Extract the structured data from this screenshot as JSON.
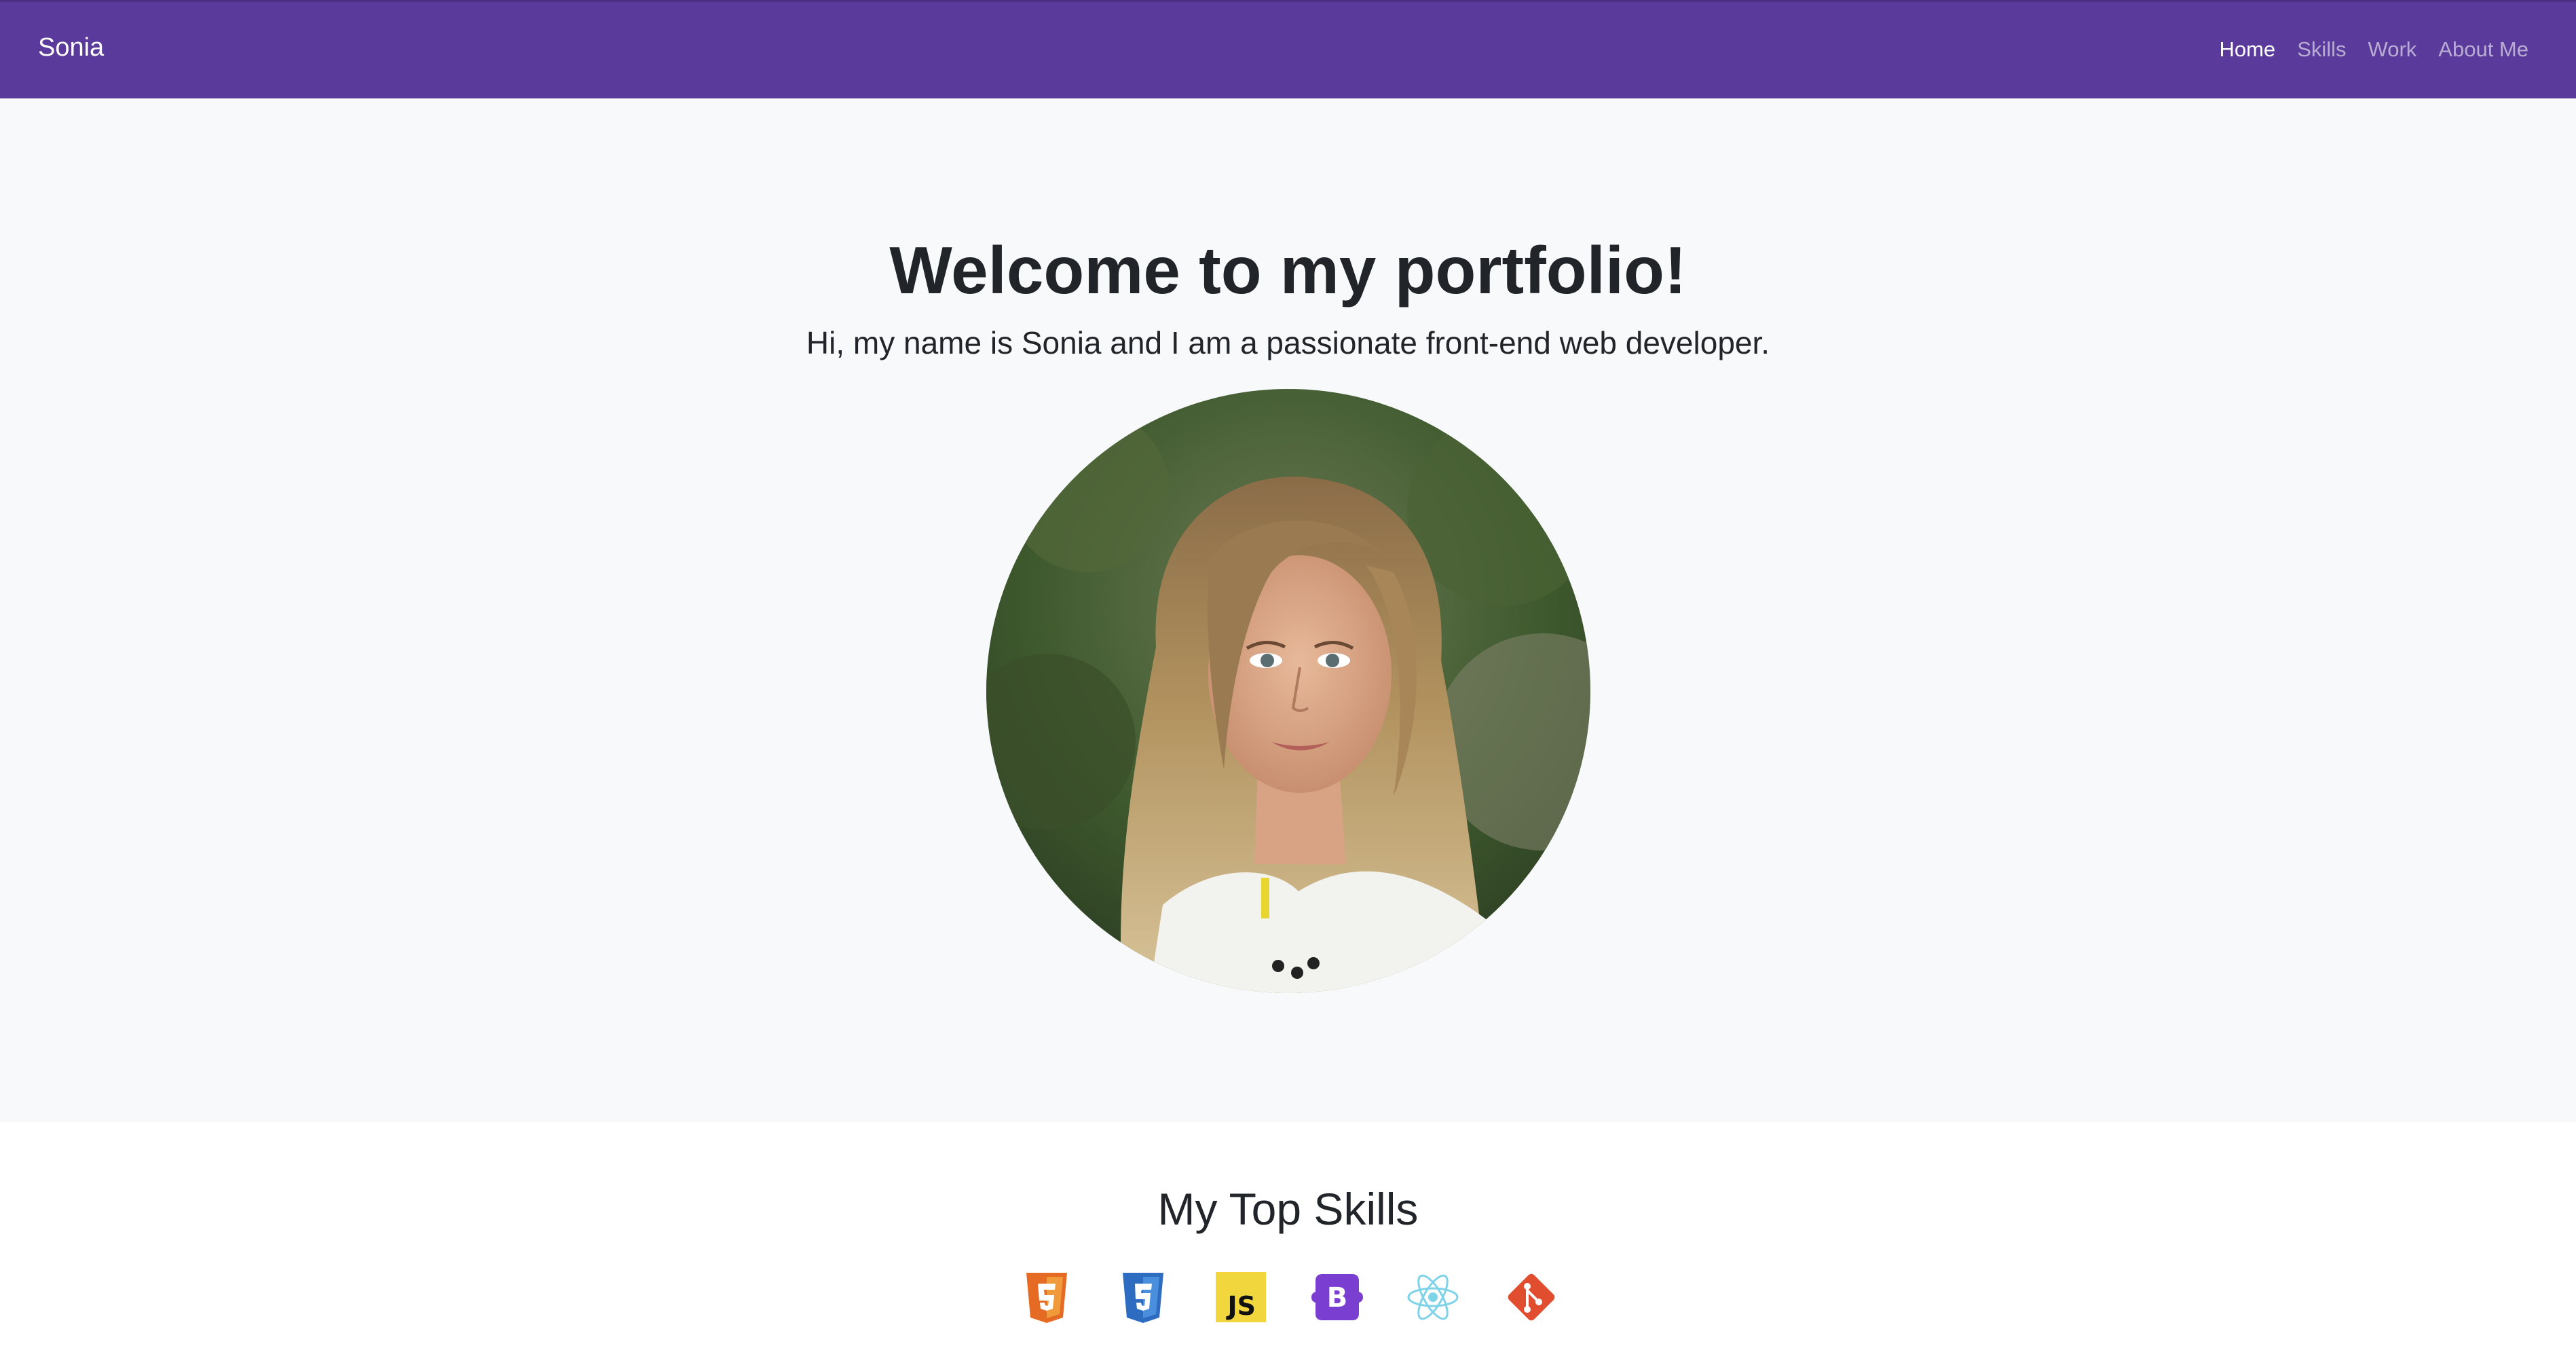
{
  "navbar": {
    "brand": "Sonia",
    "links": [
      "Home",
      "Skills",
      "Work",
      "About Me"
    ],
    "active": "Home",
    "color": "#5a3a9a"
  },
  "hero": {
    "title": "Welcome to my portfolio!",
    "subtitle": "Hi, my name is Sonia and I am a passionate front-end web developer.",
    "background": "#f8f9fa"
  },
  "skills": {
    "title": "My Top Skills",
    "icons": [
      "html5-icon",
      "css3-icon",
      "javascript-icon",
      "bootstrap-icon",
      "react-icon",
      "git-icon"
    ]
  }
}
